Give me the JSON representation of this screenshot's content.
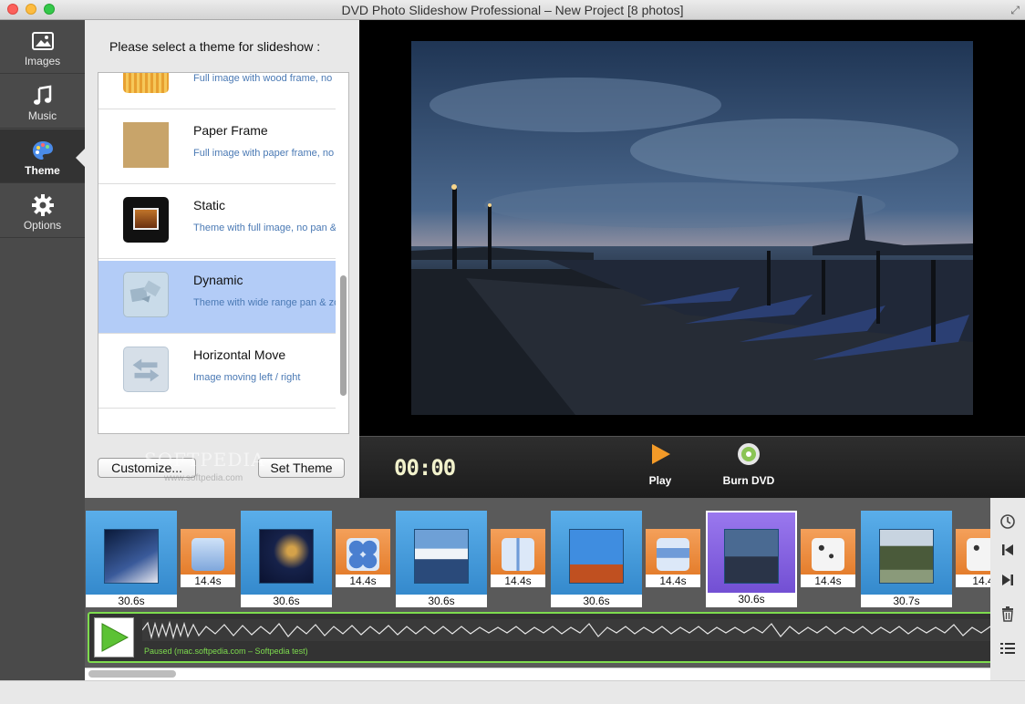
{
  "window": {
    "title": "DVD Photo Slideshow Professional – New Project [8 photos]"
  },
  "sidebar": {
    "items": [
      {
        "label": "Images",
        "icon": "image-icon"
      },
      {
        "label": "Music",
        "icon": "music-note-icon"
      },
      {
        "label": "Theme",
        "icon": "palette-icon",
        "active": true
      },
      {
        "label": "Options",
        "icon": "gear-icon"
      }
    ]
  },
  "theme_panel": {
    "title": "Please select a theme for slideshow :",
    "themes": [
      {
        "name": "",
        "description": "Full image with wood frame, no"
      },
      {
        "name": "Paper Frame",
        "description": "Full image with paper frame, no"
      },
      {
        "name": "Static",
        "description": "Theme with full image, no pan &"
      },
      {
        "name": "Dynamic",
        "description": "Theme with wide range pan & zo",
        "selected": true
      },
      {
        "name": "Horizontal Move",
        "description": "Image moving  left / right"
      }
    ],
    "customize_label": "Customize...",
    "set_theme_label": "Set Theme",
    "watermark": "SOFTPEDIA",
    "watermark_sub": "www.softpedia.com"
  },
  "player": {
    "timer": "00:00",
    "play_label": "Play",
    "burn_label": "Burn DVD"
  },
  "timeline": {
    "clips": [
      "30.6s",
      "30.6s",
      "30.6s",
      "30.6s",
      "30.6s",
      "30.7s"
    ],
    "transitions": [
      "14.4s",
      "14.4s",
      "14.4s",
      "14.4s",
      "14.4s",
      "14.4"
    ],
    "audio_status": "Paused (mac.softpedia.com – Softpedia test)"
  },
  "colors": {
    "accent": "#2f84c8",
    "selected_clip": "#6c49cf",
    "transition": "#e07420",
    "audio_border": "#7edc4e",
    "selected_theme": "#b3ccf7"
  }
}
